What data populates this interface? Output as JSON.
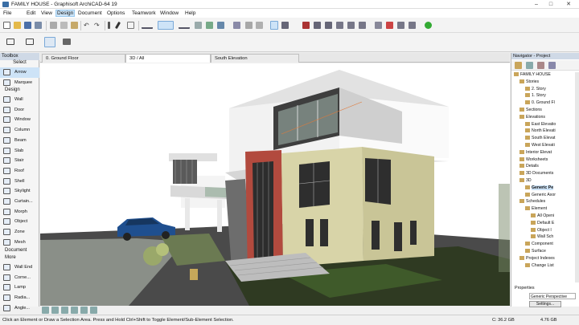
{
  "window": {
    "title": "FAMILY HOUSE - Graphisoft ArchiCAD-64 19"
  },
  "menu": [
    "File",
    "Edit",
    "View",
    "Design",
    "Document",
    "Options",
    "Teamwork",
    "Window",
    "Help"
  ],
  "menu_active": "Design",
  "toolbox": {
    "title": "Toolbox",
    "select_header": "Select",
    "select_items": [
      "Arrow",
      "Marquee"
    ],
    "design_header": "Design",
    "design_items": [
      "Wall",
      "Door",
      "Window",
      "Column",
      "Beam",
      "Slab",
      "Stair",
      "Roof",
      "Shell",
      "Skylight",
      "Curtain...",
      "Morph",
      "Object",
      "Zone",
      "Mesh"
    ],
    "document_header": "Document",
    "more_header": "More",
    "more_items": [
      "Wall End",
      "Corne...",
      "Lamp",
      "Radia...",
      "Angle..."
    ]
  },
  "tabs": [
    "0. Ground Floor",
    "3D / All",
    "South Elevation"
  ],
  "navigator": {
    "title": "Navigator - Project",
    "tree": [
      {
        "label": "FAMILY HOUSE",
        "depth": 0
      },
      {
        "label": "Stories",
        "depth": 1
      },
      {
        "label": "2. Story",
        "depth": 2
      },
      {
        "label": "1. Story",
        "depth": 2
      },
      {
        "label": "0. Ground Fl",
        "depth": 2
      },
      {
        "label": "Sections",
        "depth": 1
      },
      {
        "label": "Elevations",
        "depth": 1
      },
      {
        "label": "East Elevatio",
        "depth": 2
      },
      {
        "label": "North Elevati",
        "depth": 2
      },
      {
        "label": "South Elevat",
        "depth": 2
      },
      {
        "label": "West Elevati",
        "depth": 2
      },
      {
        "label": "Interior Elevat",
        "depth": 1
      },
      {
        "label": "Worksheets",
        "depth": 1
      },
      {
        "label": "Details",
        "depth": 1
      },
      {
        "label": "3D Documents",
        "depth": 1
      },
      {
        "label": "3D",
        "depth": 1
      },
      {
        "label": "Generic Pe",
        "depth": 2
      },
      {
        "label": "Generic Axor",
        "depth": 2
      },
      {
        "label": "Schedules",
        "depth": 1
      },
      {
        "label": "Element",
        "depth": 2
      },
      {
        "label": "All Openi",
        "depth": 3
      },
      {
        "label": "Default E",
        "depth": 3
      },
      {
        "label": "Object I",
        "depth": 3
      },
      {
        "label": "Wall Sch",
        "depth": 3
      },
      {
        "label": "Component",
        "depth": 2
      },
      {
        "label": "Surface",
        "depth": 2
      },
      {
        "label": "Project Indexes",
        "depth": 1
      },
      {
        "label": "Change List",
        "depth": 2
      }
    ],
    "properties_label": "Properties",
    "view_name": "Generic Perspective",
    "settings_button": "Settings..."
  },
  "status": {
    "message": "Click an Element or Draw a Selection Area. Press and Hold Ctrl+Shift to Toggle Element/Sub-Element Selection.",
    "disk_c": "C: 36.2 GB",
    "disk_d": "4.76 GB"
  },
  "colors": {
    "accent": "#3a6ea5",
    "selection": "#cde3f7",
    "wall_white": "#f2f2f2",
    "wall_yellow": "#d8d4a8",
    "wall_brick": "#b24a3e",
    "grass": "#3c4a2a",
    "car": "#1f4f8f"
  }
}
